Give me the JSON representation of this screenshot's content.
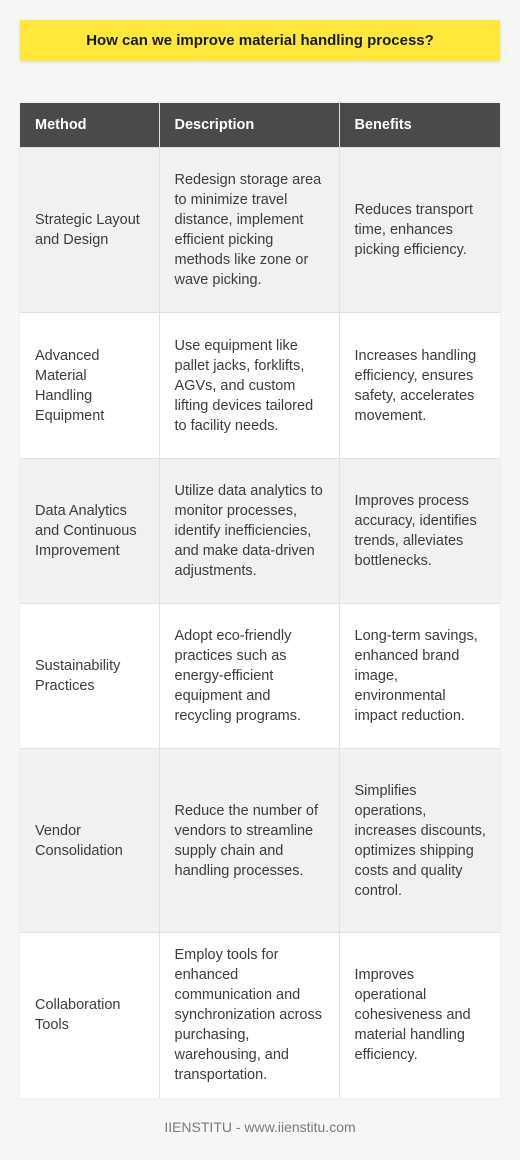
{
  "title": "How can we improve material handling process?",
  "table": {
    "headers": [
      "Method",
      "Description",
      "Benefits"
    ],
    "rows": [
      {
        "method": "Strategic Layout and Design",
        "description": "Redesign storage area to minimize travel distance, implement efficient picking methods like zone or wave picking.",
        "benefits": "Reduces transport time, enhances picking efficiency."
      },
      {
        "method": "Advanced Material Handling Equipment",
        "description": "Use equipment like pallet jacks, forklifts, AGVs, and custom lifting devices tailored to facility needs.",
        "benefits": "Increases handling efficiency, ensures safety, accelerates movement."
      },
      {
        "method": "Data Analytics and Continuous Improvement",
        "description": "Utilize data analytics to monitor processes, identify inefficiencies, and make data-driven adjustments.",
        "benefits": "Improves process accuracy, identifies trends, alleviates bottlenecks."
      },
      {
        "method": "Sustainability Practices",
        "description": "Adopt eco-friendly practices such as energy-efficient equipment and recycling programs.",
        "benefits": "Long-term savings, enhanced brand image, environmental impact reduction."
      },
      {
        "method": "Vendor Consolidation",
        "description": "Reduce the number of vendors to streamline supply chain and handling processes.",
        "benefits": "Simplifies operations, increases discounts, optimizes shipping costs and quality control."
      },
      {
        "method": "Collaboration Tools",
        "description": "Employ tools for enhanced communication and synchronization across purchasing, warehousing, and transportation.",
        "benefits": "Improves operational cohesiveness and material handling efficiency."
      }
    ]
  },
  "footer": "IIENSTITU - www.iienstitu.com",
  "colors": {
    "title_bg": "#ffe83a",
    "header_bg": "#4a4a4a",
    "row_alt_bg": "#f1f1f1",
    "row_bg": "#ffffff"
  }
}
